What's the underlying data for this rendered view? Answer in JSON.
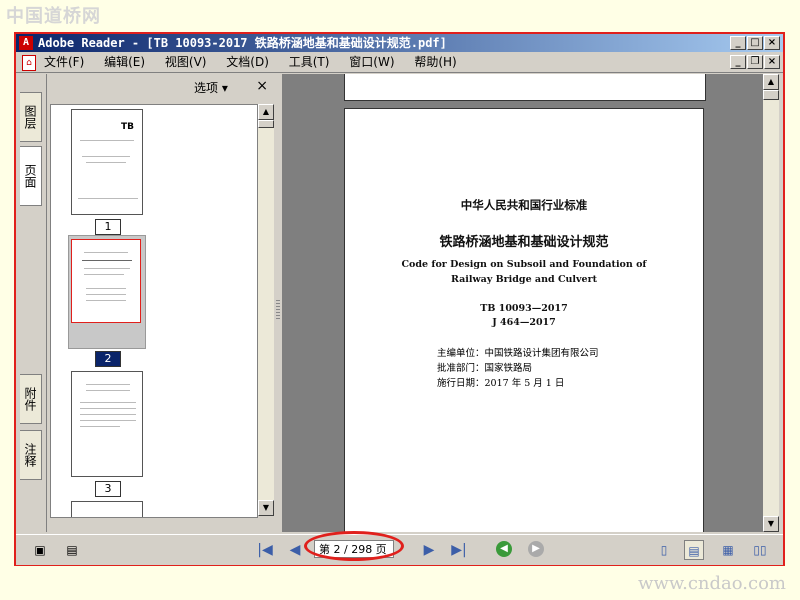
{
  "watermark": {
    "logo": "中国道桥网",
    "url": "www.cndao.com"
  },
  "window": {
    "title": "Adobe Reader - [TB 10093-2017 铁路桥涵地基和基础设计规范.pdf]",
    "buttons": {
      "minimize": "_",
      "maximize": "□",
      "close": "×",
      "restore": "❐"
    }
  },
  "menu": [
    {
      "label": "文件(F)"
    },
    {
      "label": "编辑(E)"
    },
    {
      "label": "视图(V)"
    },
    {
      "label": "文档(D)"
    },
    {
      "label": "工具(T)"
    },
    {
      "label": "窗口(W)"
    },
    {
      "label": "帮助(H)"
    }
  ],
  "side_tabs": {
    "layers": "图层",
    "pages": "页面",
    "attachments": "附件",
    "comments": "注释"
  },
  "panel": {
    "options_label": "选项 ▾",
    "close_label": "×"
  },
  "thumbnails": [
    {
      "number": "1",
      "selected": false,
      "code": "TB"
    },
    {
      "number": "2",
      "selected": true
    },
    {
      "number": "3",
      "selected": false
    }
  ],
  "document": {
    "line1": "中华人民共和国行业标准",
    "title_cn": "铁路桥涵地基和基础设计规范",
    "title_en_1": "Code for Design on Subsoil and Foundation of",
    "title_en_2": "Railway Bridge and Culvert",
    "code1": "TB 10093—2017",
    "code2": "J 464—2017",
    "editor": "主编单位：中国铁路设计集团有限公司",
    "approver": "批准部门：国家铁路局",
    "effective": "施行日期：2017 年 5 月 1 日"
  },
  "navigation": {
    "page_display": "第 2 / 298 页",
    "current_page": 2,
    "total_pages": 298
  },
  "colors": {
    "highlight": "#e0201c",
    "titlebar": "#0a246a",
    "selection": "#0a246a"
  }
}
